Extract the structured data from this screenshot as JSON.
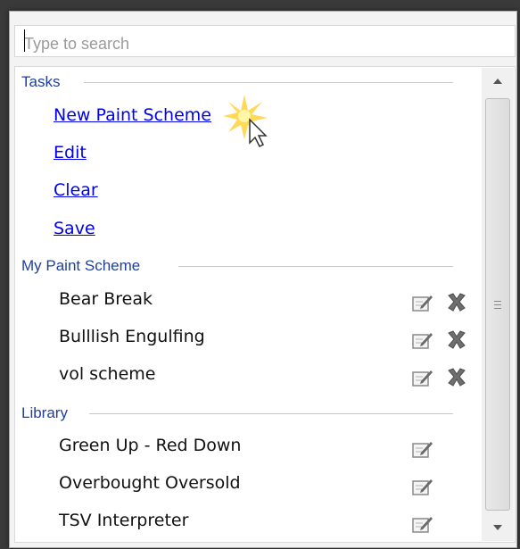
{
  "search": {
    "placeholder": "Type to search",
    "value": ""
  },
  "sections": {
    "tasks": {
      "header": "Tasks",
      "links": [
        "New Paint Scheme",
        "Edit",
        "Clear",
        "Save"
      ]
    },
    "my_paint_scheme": {
      "header": "My Paint Scheme",
      "items": [
        "Bear Break",
        "Bulllish Engulfing",
        "vol scheme"
      ]
    },
    "library": {
      "header": "Library",
      "items": [
        "Green Up  - Red Down",
        "Overbought Oversold",
        "TSV Interpreter"
      ]
    }
  },
  "icons": {
    "edit": "edit-icon",
    "delete": "delete-icon",
    "cursor": "mouse-pointer-icon"
  },
  "colors": {
    "link": "#0000ee",
    "section_header": "#1f3f9f",
    "delete_icon": "#6e6e6e",
    "cursor_glow": "#ffd23a"
  }
}
